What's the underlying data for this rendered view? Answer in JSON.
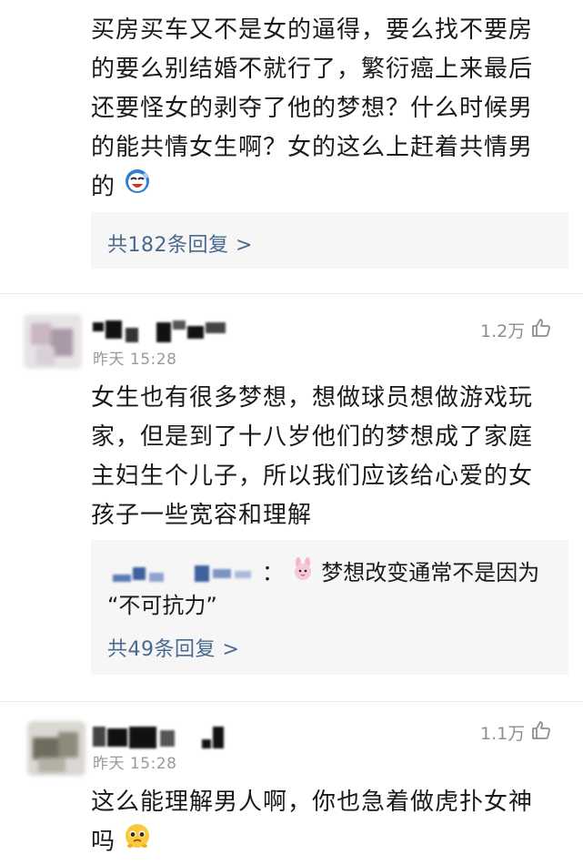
{
  "comments": [
    {
      "lines": [
        "买房买车又不是女的逼得，要么找不要房",
        "的要么别结婚不就行了，繁衍癌上来最后",
        "还要怪女的剥夺了他的梦想？什么时候男",
        "的能共情女生啊？女的这么上赶着共情男",
        "的"
      ],
      "emoji": "laughing-crying-emoji",
      "reply_count": "共182条回复 >"
    },
    {
      "time": "昨天 15:28",
      "likes": "1.2万",
      "lines": [
        "女生也有很多梦想，想做球员想做游戏玩",
        "家，但是到了十八岁他们的梦想成了家庭",
        "主妇生个儿子，所以我们应该给心爱的女",
        "孩子一些宽容和理解"
      ],
      "reply_preview_sep": "：",
      "reply_preview_line1": "梦想改变通常不是因为",
      "reply_preview_line2": "“不可抗力”",
      "reply_emoji": "pink-bunny-emoji",
      "reply_count": "共49条回复 >"
    },
    {
      "time": "昨天 15:28",
      "likes": "1.1万",
      "lines": [
        "这么能理解男人啊，你也急着做虎扑女神",
        "吗"
      ],
      "emoji": "pleading-face-emoji"
    }
  ],
  "colors": {
    "link": "#4a6a8f",
    "reply_bg": "#f6f6f6",
    "meta": "#9a9a9a"
  },
  "icons": {
    "like": "thumbs-up-outline-icon"
  }
}
